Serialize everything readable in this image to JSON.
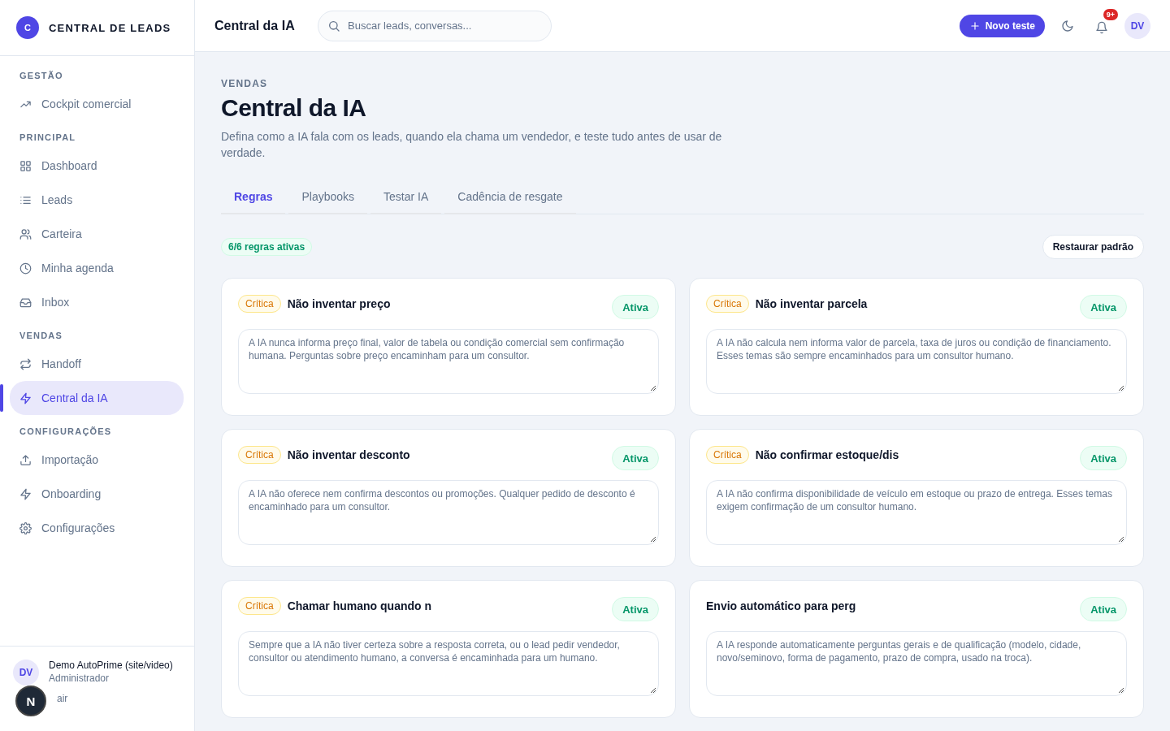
{
  "brand": {
    "logo_letter": "C",
    "name": "CENTRAL DE LEADS"
  },
  "sidebar": {
    "sections": [
      {
        "title": "GESTÃO",
        "items": [
          {
            "label": "Cockpit comercial",
            "kind": "trend",
            "selected": false
          }
        ]
      },
      {
        "title": "PRINCIPAL",
        "items": [
          {
            "label": "Dashboard",
            "kind": "grid",
            "selected": false
          },
          {
            "label": "Leads",
            "kind": "list",
            "selected": false
          },
          {
            "label": "Carteira",
            "kind": "users",
            "selected": false
          },
          {
            "label": "Minha agenda",
            "kind": "clock",
            "selected": false
          },
          {
            "label": "Inbox",
            "kind": "inbox",
            "selected": false
          }
        ]
      },
      {
        "title": "VENDAS",
        "items": [
          {
            "label": "Handoff",
            "kind": "swap",
            "selected": false
          },
          {
            "label": "Central da IA",
            "kind": "bolt",
            "selected": true
          }
        ]
      },
      {
        "title": "CONFIGURAÇÕES",
        "items": [
          {
            "label": "Importação",
            "kind": "upload",
            "selected": false
          },
          {
            "label": "Onboarding",
            "kind": "bolt",
            "selected": false
          },
          {
            "label": "Configurações",
            "kind": "gear",
            "selected": false
          }
        ]
      }
    ],
    "user": {
      "initials": "DV",
      "name": "Demo AutoPrime (site/video)",
      "role": "Administrador",
      "logout": "air"
    },
    "dev_badge": "N"
  },
  "topbar": {
    "title": "Central da IA",
    "search": {
      "placeholder": "Buscar leads, conversas..."
    },
    "new_button": "Novo teste",
    "notifications": "9+",
    "avatar": "DV"
  },
  "page": {
    "eyebrow": "VENDAS",
    "title": "Central da IA",
    "description": "Defina como a IA fala com os leads, quando ela chama um vendedor, e teste tudo antes de usar de verdade."
  },
  "tabs": [
    {
      "label": "Regras",
      "selected": true
    },
    {
      "label": "Playbooks",
      "selected": false
    },
    {
      "label": "Testar IA",
      "selected": false
    },
    {
      "label": "Cadência de resgate",
      "selected": false
    }
  ],
  "summary": {
    "count": "6/6 regras ativas",
    "restore_button": "Restaurar padrão"
  },
  "rules": [
    {
      "kind": "critical",
      "badge": "Crítica",
      "title": "Não inventar preço",
      "status": "Ativa",
      "active": true,
      "description": "A IA nunca informa preço final, valor de tabela ou condição comercial sem confirmação humana. Perguntas sobre preço encaminham para um consultor."
    },
    {
      "kind": "critical",
      "badge": "Crítica",
      "title": "Não inventar parcela",
      "status": "Ativa",
      "active": true,
      "description": "A IA não calcula nem informa valor de parcela, taxa de juros ou condição de financiamento. Esses temas são sempre encaminhados para um consultor humano."
    },
    {
      "kind": "critical",
      "badge": "Crítica",
      "title": "Não inventar desconto",
      "status": "Ativa",
      "active": true,
      "description": "A IA não oferece nem confirma descontos ou promoções. Qualquer pedido de desconto é encaminhado para um consultor."
    },
    {
      "kind": "critical",
      "badge": "Crítica",
      "title": "Não confirmar estoque/dis",
      "status": "Ativa",
      "active": true,
      "description": "A IA não confirma disponibilidade de veículo em estoque ou prazo de entrega. Esses temas exigem confirmação de um consultor humano."
    },
    {
      "kind": "critical",
      "badge": "Crítica",
      "title": "Chamar humano quando n",
      "status": "Ativa",
      "active": true,
      "description": "Sempre que a IA não tiver certeza sobre a resposta correta, ou o lead pedir vendedor, consultor ou atendimento humano, a conversa é encaminhada para um humano."
    },
    {
      "kind": "normal",
      "title": "Envio automático para perg",
      "status": "Ativa",
      "active": true,
      "description": "A IA responde automaticamente perguntas gerais e de qualificação (modelo, cidade, novo/seminovo, forma de pagamento, prazo de compra, usado na troca)."
    }
  ]
}
